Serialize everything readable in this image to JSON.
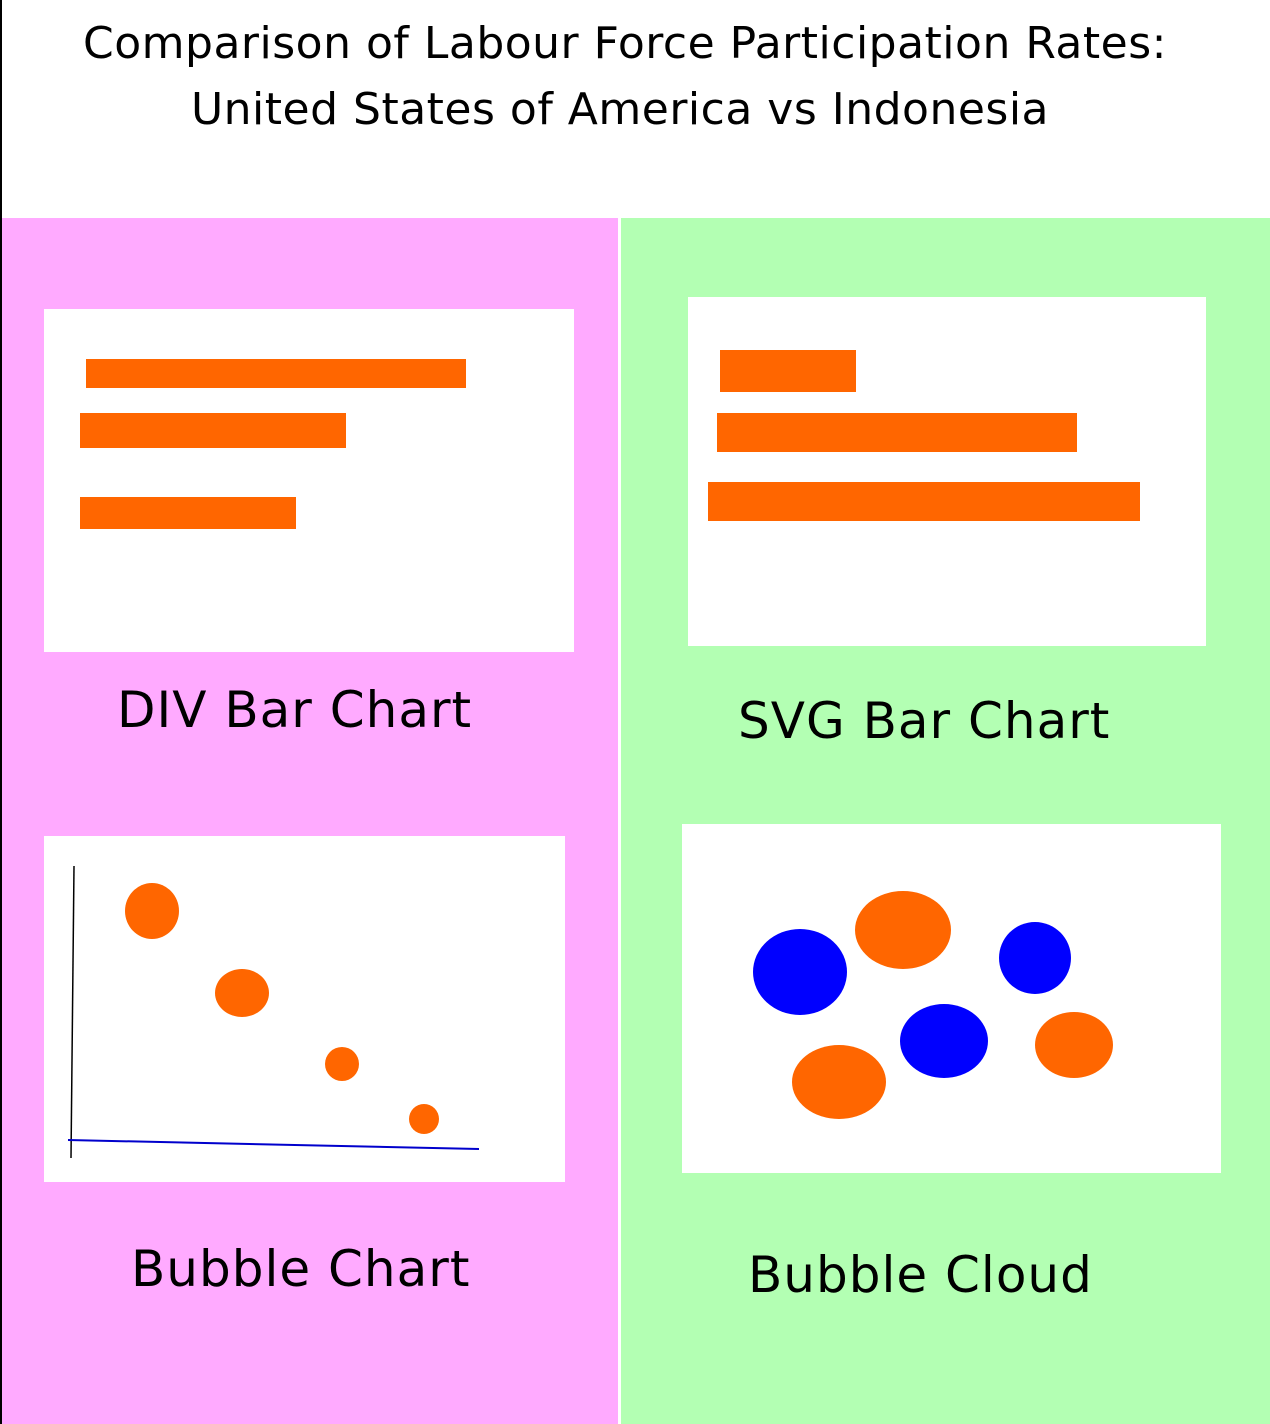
{
  "title": {
    "line1": "Comparison of Labour Force Participation Rates:",
    "line2": "United States of America vs Indonesia"
  },
  "colors": {
    "left_panel": "#ffaaff",
    "right_panel": "#b3ffb3",
    "bar": "#ff6600",
    "bubble_orange": "#ff6600",
    "bubble_blue": "#0000ff",
    "axis_y": "#000000",
    "axis_x": "#0000cc"
  },
  "cards": {
    "div_bar": {
      "caption": "DIV Bar Chart"
    },
    "svg_bar": {
      "caption": "SVG Bar Chart"
    },
    "bubble_chart": {
      "caption": "Bubble Chart"
    },
    "bubble_cloud": {
      "caption": "Bubble Cloud"
    }
  }
}
